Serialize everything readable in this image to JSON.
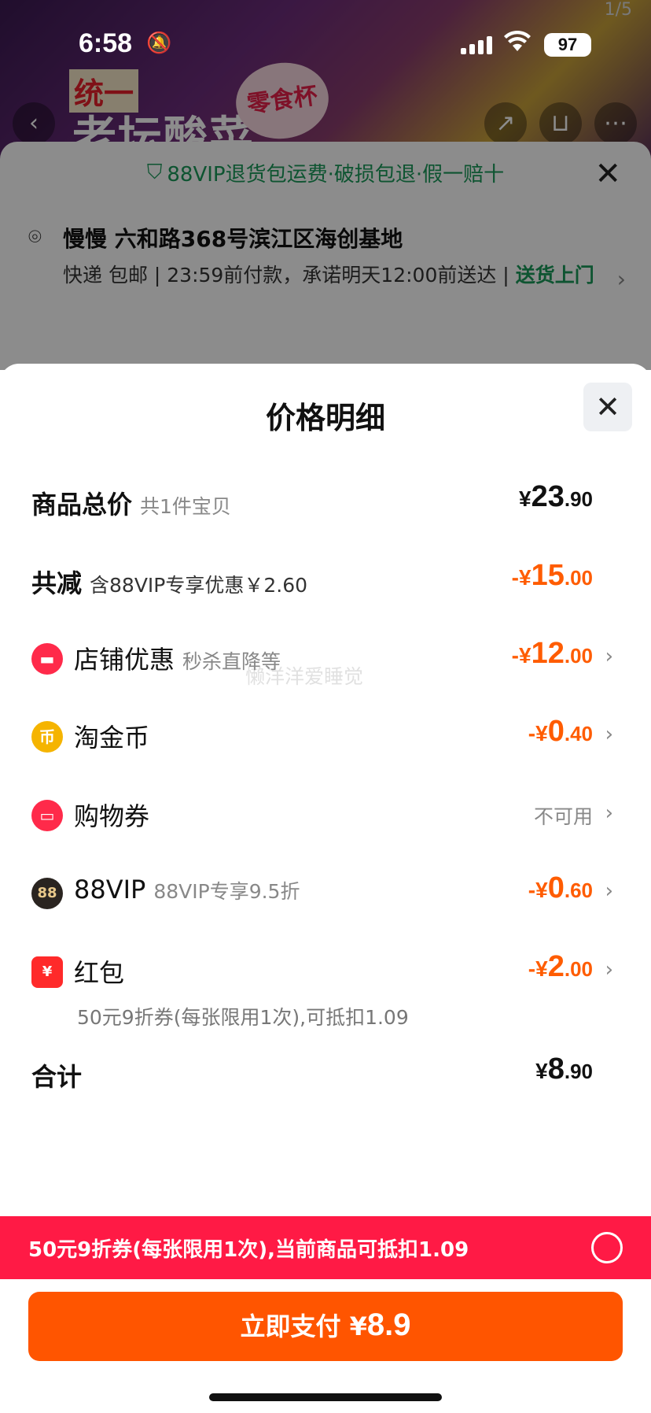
{
  "status_bar": {
    "time": "6:58",
    "battery": "97"
  },
  "hero": {
    "pager": "1/5",
    "brand": "统一",
    "slogan": "老坛酸菜",
    "badge": "零食杯"
  },
  "order_panel": {
    "vip_banner": "88VIP退货包运费·破损包退·假一赔十",
    "address": "慢慢 六和路368号滨江区海创基地",
    "shipping_prefix": "快递 包邮 | 23:59前付款，承诺明天12:00前送达 | ",
    "shipping_highlight": "送货上门"
  },
  "sheet": {
    "title": "价格明细",
    "watermark": "懒洋洋爱睡觉",
    "rows": {
      "total": {
        "label": "商品总价",
        "sub": "共1件宝贝",
        "currency": "¥",
        "int": "23",
        "dec": ".90"
      },
      "discount": {
        "label": "共减",
        "sub": "含88VIP专享优惠￥2.60",
        "currency": "-¥",
        "int": "15",
        "dec": ".00"
      },
      "shop": {
        "label": "店铺优惠",
        "sub": "秒杀直降等",
        "currency": "-¥",
        "int": "12",
        "dec": ".00"
      },
      "coin": {
        "label": "淘金币",
        "currency": "-¥",
        "int": "0",
        "dec": ".40"
      },
      "voucher": {
        "label": "购物券",
        "status": "不可用"
      },
      "vip": {
        "label": "88VIP",
        "sub": "88VIP专享9.5折",
        "currency": "-¥",
        "int": "0",
        "dec": ".60",
        "icon_text": "88"
      },
      "redpacket": {
        "label": "红包",
        "note": "50元9折券(每张限用1次),可抵扣1.09",
        "currency": "-¥",
        "int": "2",
        "dec": ".00"
      },
      "sum": {
        "label": "合计",
        "currency": "¥",
        "int": "8",
        "dec": ".90"
      }
    }
  },
  "coupon_bar": {
    "text": "50元9折券(每张限用1次),当前商品可抵扣1.09"
  },
  "pay_button": {
    "label": "立即支付 ",
    "currency": "¥",
    "amount": "8.9"
  },
  "colors": {
    "accent": "#ff5500",
    "discount": "#ff5c00",
    "coupon_bar": "#ff1a45",
    "vip_green": "#1a9a5a"
  }
}
